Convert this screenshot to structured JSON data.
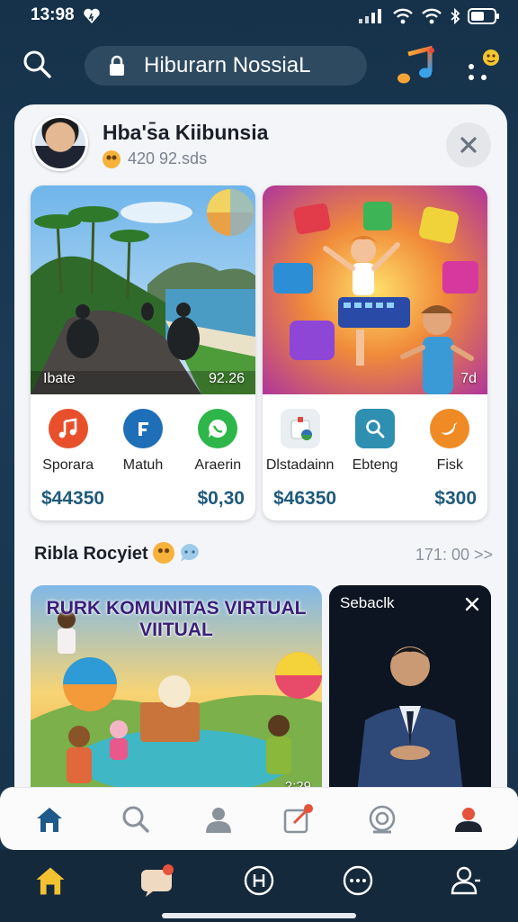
{
  "status_bar": {
    "time": "13:98"
  },
  "header": {
    "title": "Hiburarn NossiaL"
  },
  "profile": {
    "name": "Hba's̄a Kiibunsia",
    "subtitle": "420 92.sds"
  },
  "cards": [
    {
      "image_caption": "Ibate",
      "image_count": "92.26",
      "apps": [
        {
          "label": "Sporara",
          "icon": "music-note-icon",
          "color": "#e8502c"
        },
        {
          "label": "Matuh",
          "icon": "music-app-icon",
          "color": "#1f6fb8"
        },
        {
          "label": "Araerin",
          "icon": "chat-bubble-icon",
          "color": "#2fb64a"
        }
      ],
      "prices": [
        "$44350",
        "$0,30"
      ]
    },
    {
      "image_count": "7d",
      "apps": [
        {
          "label": "Dlstadainn",
          "icon": "document-icon",
          "color": "#e9eef2"
        },
        {
          "label": "Ebteng",
          "icon": "search-app-icon",
          "color": "#2e8fb0"
        },
        {
          "label": "Fisk",
          "icon": "bird-icon",
          "color": "#ef8a25"
        }
      ],
      "prices": [
        "$46350",
        "$300"
      ]
    }
  ],
  "section": {
    "title": "Ribla Rocyiet",
    "time": "171: 00 >>"
  },
  "community": {
    "title": "RURK KOMUNITAS VIRTUAL VIITUAL",
    "count": "2:29"
  },
  "video": {
    "title": "Sebaclk"
  },
  "colors": {
    "accent": "#1f5a7c",
    "background": "#16324a",
    "nav_active": "#1f5a8a",
    "home_yellow": "#f2c230"
  }
}
